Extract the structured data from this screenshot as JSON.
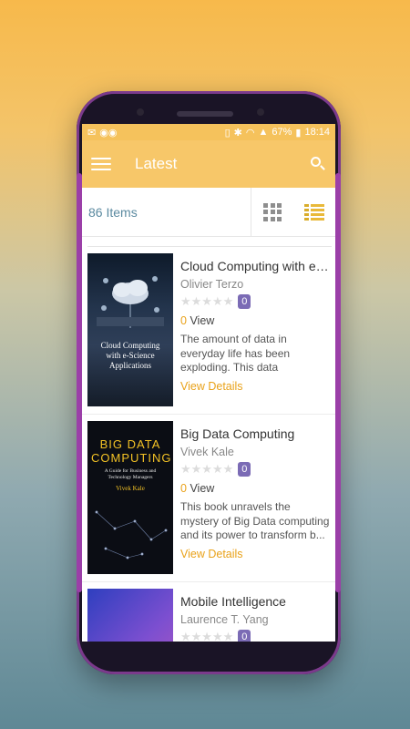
{
  "statusbar": {
    "battery": "67%",
    "time": "18:14"
  },
  "appbar": {
    "title": "Latest"
  },
  "toolbar": {
    "items_count": "86 Items"
  },
  "books": [
    {
      "title": "Cloud Computing with e-Science Applications",
      "author": "Olivier Terzo",
      "rating_count": "0",
      "views_count": "0",
      "views_label": "View",
      "description": "The amount of data in everyday life has been exploding. This data increases...",
      "details_label": "View Details",
      "cover_title": "Cloud Computing with e-Science Applications"
    },
    {
      "title": "Big Data Computing",
      "author": "Vivek Kale",
      "rating_count": "0",
      "views_count": "0",
      "views_label": "View",
      "description": "This book unravels the mystery of Big Data computing and its power to transform b...",
      "details_label": "View Details",
      "cover_title": "BIG DATA COMPUTING",
      "cover_subtitle": "A Guide for Business and Technology Managers",
      "cover_author": "Vivek Kale"
    },
    {
      "title": "Mobile Intelligence",
      "author": "Laurence T. Yang",
      "rating_count": "0"
    }
  ]
}
